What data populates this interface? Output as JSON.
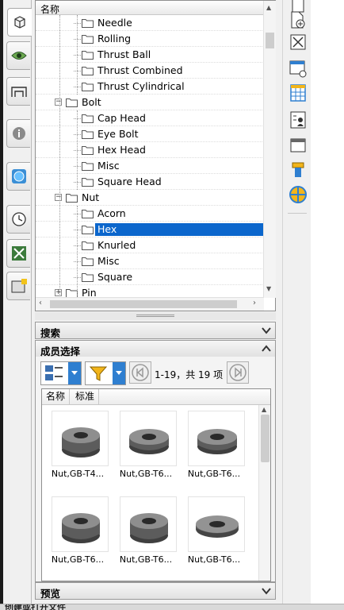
{
  "tree": {
    "header": "名称",
    "rows": [
      {
        "label": "Needle",
        "level": 2
      },
      {
        "label": "Rolling",
        "level": 2
      },
      {
        "label": "Thrust Ball",
        "level": 2
      },
      {
        "label": "Thrust Combined",
        "level": 2
      },
      {
        "label": "Thrust Cylindrical",
        "level": 2
      },
      {
        "label": "Bolt",
        "level": 1,
        "expander": "−"
      },
      {
        "label": "Cap Head",
        "level": 2
      },
      {
        "label": "Eye Bolt",
        "level": 2
      },
      {
        "label": "Hex Head",
        "level": 2
      },
      {
        "label": "Misc",
        "level": 2
      },
      {
        "label": "Square Head",
        "level": 2
      },
      {
        "label": "Nut",
        "level": 1,
        "expander": "−"
      },
      {
        "label": "Acorn",
        "level": 2
      },
      {
        "label": "Hex",
        "level": 2,
        "selected": true
      },
      {
        "label": "Knurled",
        "level": 2
      },
      {
        "label": "Misc",
        "level": 2
      },
      {
        "label": "Square",
        "level": 2
      },
      {
        "label": "Pin",
        "level": 1,
        "expander": "+"
      }
    ]
  },
  "sections": {
    "search": "搜索",
    "member_select": "成员选择",
    "preview": "预览"
  },
  "member": {
    "range_text": "1-19，共 19 项",
    "columns": [
      "名称",
      "标准"
    ],
    "items": [
      {
        "caption": "Nut,GB-T4...",
        "variant": "hex-tall"
      },
      {
        "caption": "Nut,GB-T6...",
        "variant": "hex-flat"
      },
      {
        "caption": "Nut,GB-T6...",
        "variant": "hex-flat"
      },
      {
        "caption": "Nut,GB-T6...",
        "variant": "hex-tall"
      },
      {
        "caption": "Nut,GB-T6...",
        "variant": "hex-tall"
      },
      {
        "caption": "Nut,GB-T6...",
        "variant": "hex-thin"
      }
    ]
  },
  "colors": {
    "selection": "#0b66cc",
    "accent_icon_blue": "#2f7fd0",
    "accent_icon_yellow": "#f2b51b"
  },
  "status": {
    "text": "创建或打开文件"
  }
}
